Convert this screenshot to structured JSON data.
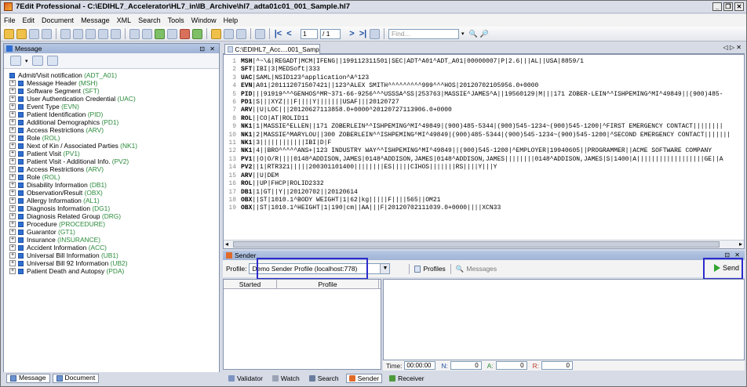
{
  "window": {
    "title": "7Edit Professional - C:\\EDIHL7_Accelerator\\HL7_in\\IB_Archive\\hl7_adta01c01_001_Sample.hl7"
  },
  "menu": [
    "File",
    "Edit",
    "Document",
    "Message",
    "XML",
    "Search",
    "Tools",
    "Window",
    "Help"
  ],
  "toolbar": {
    "page_value": "1",
    "page_total": "/ 1",
    "find_placeholder": "Find..."
  },
  "message_panel": {
    "title": "Message",
    "root": "Admit/Visit notification",
    "root_code": "(ADT_A01)",
    "items": [
      {
        "label": "Message Header",
        "code": "(MSH)"
      },
      {
        "label": "Software Segment",
        "code": "(SFT)"
      },
      {
        "label": "User Authentication Credential",
        "code": "(UAC)"
      },
      {
        "label": "Event Type",
        "code": "(EVN)"
      },
      {
        "label": "Patient Identification",
        "code": "(PID)"
      },
      {
        "label": "Additional Demographics",
        "code": "(PD1)"
      },
      {
        "label": "Access Restrictions",
        "code": "(ARV)"
      },
      {
        "label": "Role",
        "code": "(ROL)"
      },
      {
        "label": "Next of Kin / Associated Parties",
        "code": "(NK1)"
      },
      {
        "label": "Patient Visit",
        "code": "(PV1)"
      },
      {
        "label": "Patient Visit - Additional Info.",
        "code": "(PV2)"
      },
      {
        "label": "Access Restrictions",
        "code": "(ARV)"
      },
      {
        "label": "Role",
        "code": "(ROL)"
      },
      {
        "label": "Disability Information",
        "code": "(DB1)"
      },
      {
        "label": "Observation/Result",
        "code": "(OBX)"
      },
      {
        "label": "Allergy Information",
        "code": "(AL1)"
      },
      {
        "label": "Diagnosis Information",
        "code": "(DG1)"
      },
      {
        "label": "Diagnosis Related Group",
        "code": "(DRG)"
      },
      {
        "label": "Procedure",
        "code": "(PROCEDURE)"
      },
      {
        "label": "Guarantor",
        "code": "(GT1)"
      },
      {
        "label": "Insurance",
        "code": "(INSURANCE)"
      },
      {
        "label": "Accident Information",
        "code": "(ACC)"
      },
      {
        "label": "Universal Bill Information",
        "code": "(UB1)"
      },
      {
        "label": "Universal Bill 92 Information",
        "code": "(UB2)"
      },
      {
        "label": "Patient Death and Autopsy",
        "code": "(PDA)"
      }
    ],
    "tabs": [
      "Message",
      "Document"
    ]
  },
  "editor": {
    "tab_label": "C:\\EDIHL7_Acc....001_Sample.hl7",
    "lines": [
      {
        "seg": "MSH",
        "rest": "|^~\\&|REGADT|MCM|IFENG||199112311501|SEC|ADT^A01^ADT_A01|00000007|P|2.6|||AL||USA|8859/1"
      },
      {
        "seg": "SFT",
        "rest": "|IBI|3|MEDSoft|333"
      },
      {
        "seg": "UAC",
        "rest": "|SAML|NSID123^application^A^123"
      },
      {
        "seg": "EVN",
        "rest": "|A01|201112071507421||123^ALEX SMITH^^^^^^^^^999^^^HOS|20120702105956.0+0000"
      },
      {
        "seg": "PID",
        "rest": "|||91919^^^GENHOS^MR~371-66-9256^^^USSSA^SS|253763|MASSIE^JAMES^A||19560129|M|||171 ZOBER-LEIN^^ISHPEMING^MI^49849||(900)485-"
      },
      {
        "seg": "PD1",
        "rest": "|S|||XYZ|||F||||Y|||||||USAF|||20120727"
      },
      {
        "seg": "ARV",
        "rest": "||U|LOC|||20120627113858.0+0000^20120727113906.0+0000"
      },
      {
        "seg": "ROL",
        "rest": "||CO|AT|ROLID11"
      },
      {
        "seg": "NK1",
        "rest": "|1|MASSIE^ELLEN||171 ZOBERLEIN^^ISHPEMING^MI^49849|(900)485-5344|(900)545-1234~(900)545-1200|^FIRST EMERGENCY CONTACT||||||||"
      },
      {
        "seg": "NK1",
        "rest": "|2|MASSIE^MARYLOU||300 ZOBERLEIN^^ISHPEMING^MI^49849|(900)485-5344|(900)545-1234~(900)545-1200|^SECOND EMERGENCY CONTACT|||||||"
      },
      {
        "seg": "NK1",
        "rest": "|3||||||||||||IBI|D|F"
      },
      {
        "seg": "NK1",
        "rest": "|4||BRO^^^^^ANS+|123 INDUSTRY WAY^^ISHPEMING^MI^49849||(900)545-1200|^EMPLOYER|19940605||PROGRAMMER||ACME SOFTWARE COMPANY"
      },
      {
        "seg": "PV1",
        "rest": "||O|O/R||||0148^ADDISON,JAMES|0148^ADDISON,JAMES|0148^ADDISON,JAMES||||||||0148^ADDISON,JAMES|S|1400|A||||||||||||||||||GE||A"
      },
      {
        "seg": "PV2",
        "rest": "||1|RTR321|||||200301101400||||||||ES|||||CIHOS|||||||RS||||Y|||Y"
      },
      {
        "seg": "ARV",
        "rest": "||U|DEM"
      },
      {
        "seg": "ROL",
        "rest": "||UP|FHCP|ROLID2332"
      },
      {
        "seg": "DB1",
        "rest": "|1|GT||Y||20120702||20120614"
      },
      {
        "seg": "OBX",
        "rest": "||ST|1010.1^BODY WEIGHT|1|62|kg|||||F||||565||OM21"
      },
      {
        "seg": "OBX",
        "rest": "||ST|1010.1^HEIGHT|1|190|cm||AA|||F|20120702111039.0+0000||||XCN33"
      }
    ]
  },
  "sender": {
    "title": "Sender",
    "profile_label": "Profile:",
    "profile_value": "Demo Sender Profile (localhost:778)",
    "profiles_button": "Profiles",
    "messages_button": "Messages",
    "send_button": "Send",
    "col_started": "Started",
    "col_profile": "Profile",
    "time_label": "Time:",
    "time_value": "00:00:00",
    "n_label": "N:",
    "n_value": "0",
    "a_label": "A:",
    "a_value": "0",
    "r_label": "R:",
    "r_value": "0"
  },
  "bottom_tabs": [
    "Validator",
    "Watch",
    "Search",
    "Sender",
    "Receiver"
  ]
}
